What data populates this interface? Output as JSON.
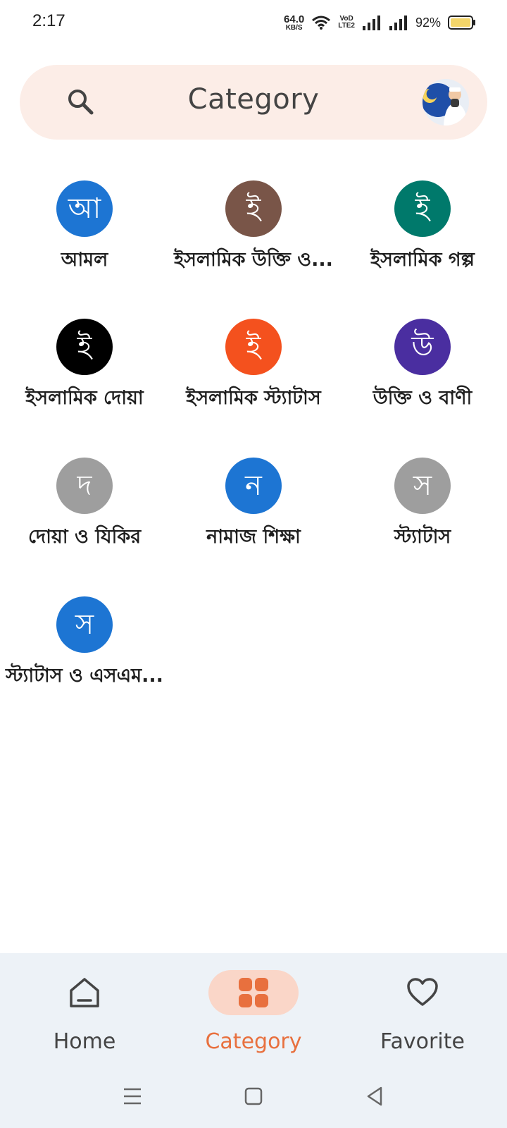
{
  "status_bar": {
    "time": "2:17",
    "net_speed_value": "64.0",
    "net_speed_unit": "KB/S",
    "volte_top": "VoD",
    "volte_bottom": "LTE2",
    "battery_percent": "92%"
  },
  "search": {
    "title": "Category",
    "icon": "search-icon",
    "avatar": "profile-avatar"
  },
  "categories": [
    {
      "initial": "আ",
      "label": "আমল",
      "color": "#1d75d3"
    },
    {
      "initial": "ই",
      "label": "ইসলামিক উক্তি ও...",
      "color": "#795548"
    },
    {
      "initial": "ই",
      "label": "ইসলামিক গল্প",
      "color": "#00796b"
    },
    {
      "initial": "ই",
      "label": "ইসলামিক দোয়া",
      "color": "#000000"
    },
    {
      "initial": "ই",
      "label": "ইসলামিক স্ট্যাটাস",
      "color": "#f4511e"
    },
    {
      "initial": "উ",
      "label": "উক্তি ও বাণী",
      "color": "#4a2ea0"
    },
    {
      "initial": "দ",
      "label": "দোয়া ও যিকির",
      "color": "#9e9e9e"
    },
    {
      "initial": "ন",
      "label": "নামাজ শিক্ষা",
      "color": "#1d75d3"
    },
    {
      "initial": "স",
      "label": "স্ট্যাটাস",
      "color": "#9e9e9e"
    },
    {
      "initial": "স",
      "label": "স্ট্যাটাস ও এসএম...",
      "color": "#1d75d3"
    }
  ],
  "bottom_nav": {
    "items": [
      {
        "label": "Home",
        "icon": "home-icon",
        "active": false
      },
      {
        "label": "Category",
        "icon": "grid-icon",
        "active": true
      },
      {
        "label": "Favorite",
        "icon": "heart-icon",
        "active": false
      }
    ],
    "accent_color": "#e8703e"
  },
  "system_nav": {
    "icons": [
      "menu-icon",
      "home-square-icon",
      "back-icon"
    ]
  }
}
